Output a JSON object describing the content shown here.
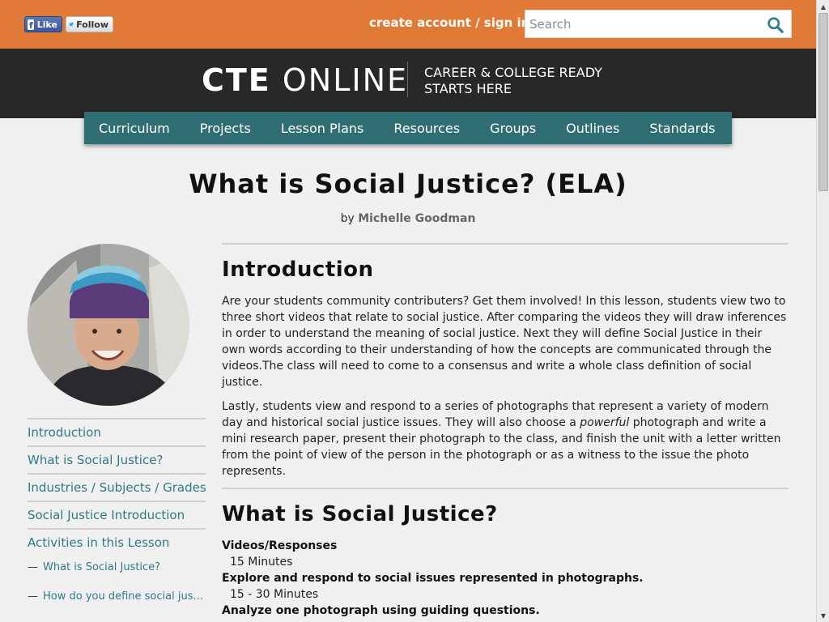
{
  "topbar": {
    "like_label": "Like",
    "follow_label": "Follow",
    "auth_link": "create account / sign in",
    "search_placeholder": "Search"
  },
  "header": {
    "logo_bold": "CTE",
    "logo_light": "ONLINE",
    "tagline_line1": "CAREER & COLLEGE READY",
    "tagline_line2": "STARTS HERE"
  },
  "nav": [
    "Curriculum",
    "Projects",
    "Lesson Plans",
    "Resources",
    "Groups",
    "Outlines",
    "Standards"
  ],
  "page": {
    "title": "What is Social Justice? (ELA)",
    "by_prefix": "by",
    "author": "Michelle Goodman"
  },
  "toc": {
    "items": [
      "Introduction",
      "What is Social Justice?",
      "Industries / Subjects / Grades",
      "Social Justice Introduction",
      "Activities in this Lesson"
    ],
    "sub_items": [
      "What is Social Justice?",
      "How do you define social jus..."
    ],
    "dash": "—"
  },
  "intro": {
    "heading": "Introduction",
    "para1": "Are your students community contributers? Get them involved! In this lesson, students view two to three short videos that relate to social justice. After comparing the videos they will draw inferences in order to understand the meaning of social justice. Next they will define Social Justice in their own words according to their understanding of how the concepts are communicated through the videos.The class will need to come to a consensus and write a whole class definition of social justice.",
    "para2_before": "Lastly, students view and respond to a series of photographs that represent a variety of modern day and historical social justice issues. They will also choose a ",
    "para2_em": "powerful",
    "para2_after": " photograph and write a mini research paper, present their photograph to the class, and finish the unit with a letter written from the point of view of the person in the photograph or as a witness to the issue the photo represents."
  },
  "section2": {
    "heading": "What is Social Justice?",
    "activities": [
      {
        "title": "Videos/Responses",
        "time": "15 Minutes"
      },
      {
        "title": "Explore and respond to social issues represented in photographs.",
        "time": "15 - 30 Minutes"
      },
      {
        "title": "Analyze one photograph using guiding questions.",
        "time": ""
      }
    ]
  },
  "colors": {
    "topbar": "#e07a36",
    "header": "#282828",
    "nav": "#2f6e72",
    "link": "#2e7a87"
  }
}
